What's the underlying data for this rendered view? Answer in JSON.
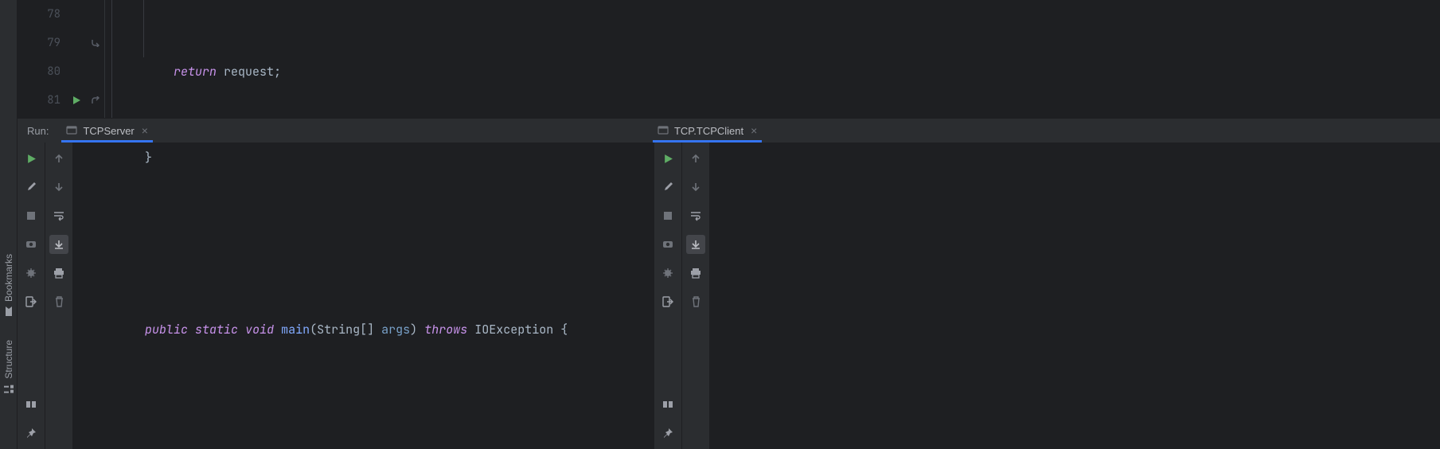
{
  "editor": {
    "line_numbers": [
      "78",
      "79",
      "80",
      "81"
    ],
    "lines": {
      "l78": {
        "return": "return",
        "ident": "request",
        "semi": ";"
      },
      "l79": {
        "brace": "}"
      },
      "l81": {
        "public": "public",
        "static": "static",
        "void": "void",
        "main": "main",
        "lparen": "(",
        "string_arr": "String[]",
        "args": "args",
        "rparen": ")",
        "throws": "throws",
        "exc": "IOException",
        "lbrace": "{"
      }
    }
  },
  "run": {
    "label": "Run:",
    "tabs": [
      {
        "name": "TCPServer"
      },
      {
        "name": "TCP.TCPClient"
      }
    ]
  },
  "sidebar": {
    "bookmarks": "Bookmarks",
    "structure": "Structure"
  },
  "icons": {
    "run_triangle": "run-icon",
    "wrench": "wrench-icon",
    "stop": "stop-icon",
    "camera": "camera-icon",
    "bug": "debug-icon",
    "exit": "exit-icon",
    "layout": "layout-icon",
    "pin": "pin-icon",
    "arrow_up": "arrow-up-icon",
    "arrow_down": "arrow-down-icon",
    "wrap": "soft-wrap-icon",
    "scroll_end": "scroll-to-end-icon",
    "print": "print-icon",
    "trash": "trash-icon"
  }
}
